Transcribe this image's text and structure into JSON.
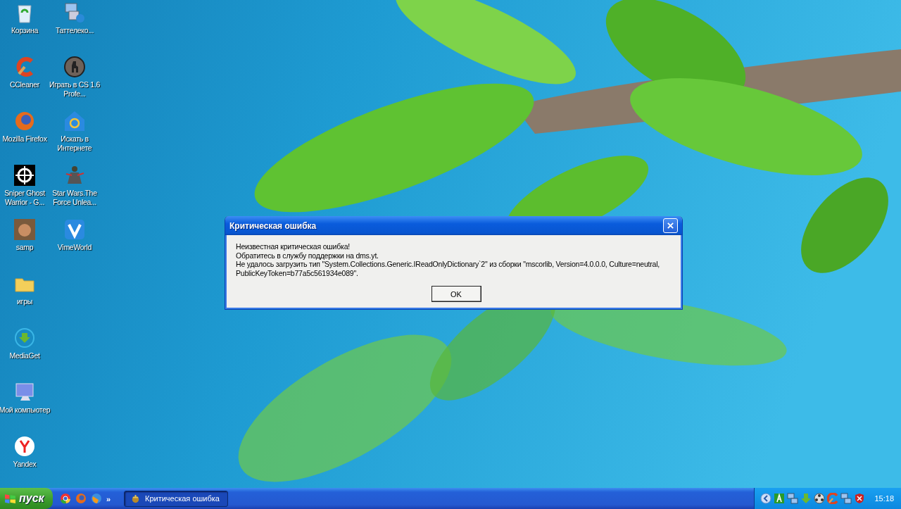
{
  "desktop_icons": [
    {
      "label": "Корзина"
    },
    {
      "label": "CCleaner"
    },
    {
      "label": "Mozilla Firefox"
    },
    {
      "label": "Sniper Ghost Warrior - G..."
    },
    {
      "label": "samp"
    },
    {
      "label": "игры"
    },
    {
      "label": "MediaGet"
    },
    {
      "label": "Мой компьютер"
    },
    {
      "label": "Yandex"
    },
    {
      "label": "Таттелеко..."
    },
    {
      "label": "Играть в CS 1.6 Profe..."
    },
    {
      "label": "Искать в Интернете"
    },
    {
      "label": "Star Wars.The Force Unlea..."
    },
    {
      "label": "VimeWorld"
    }
  ],
  "dialog": {
    "title": "Критическая ошибка",
    "lines": [
      "Неизвестная критическая ошибка!",
      "Обратитесь в службу поддержки на dms.yt.",
      "Не удалось загрузить тип \"System.Collections.Generic.IReadOnlyDictionary`2\" из сборки \"mscorlib, Version=4.0.0.0, Culture=neutral, PublicKeyToken=b77a5c561934e089\"."
    ],
    "button": "OK"
  },
  "taskbar": {
    "start": "пуск",
    "quick_launch_more": "»",
    "tasks": [
      {
        "label": "Критическая ошибка",
        "selected": true
      }
    ],
    "clock": "15:18"
  }
}
